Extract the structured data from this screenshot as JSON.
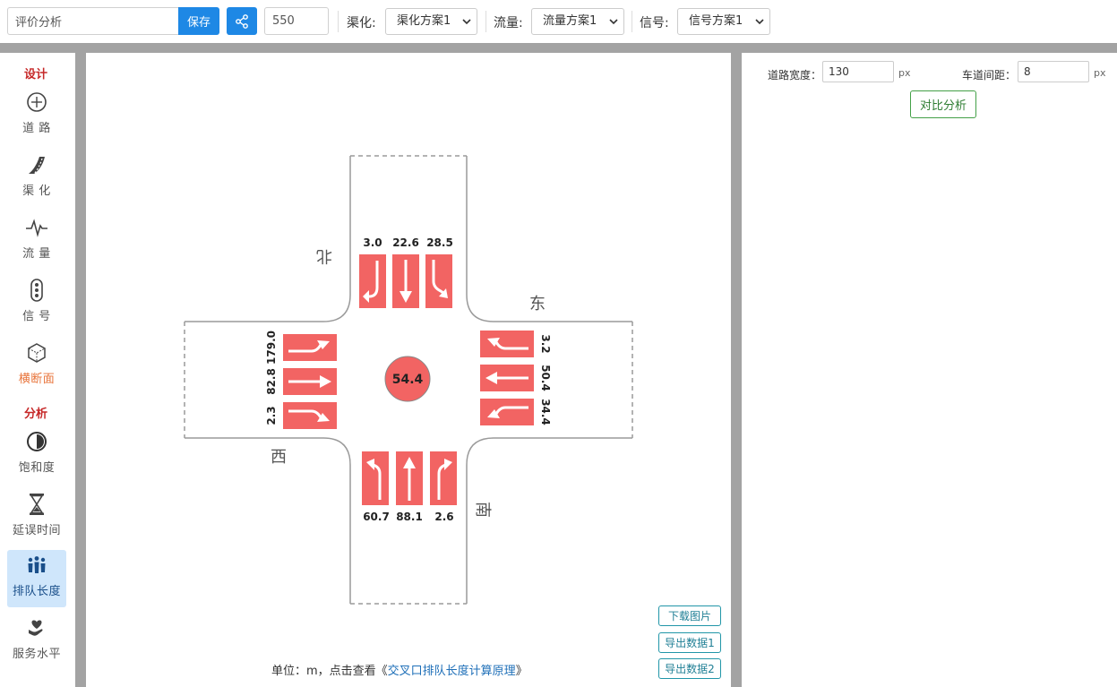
{
  "toolbar": {
    "name_value": "评价分析",
    "save_label": "保存",
    "number_value": "550",
    "channelization_label": "渠化:",
    "channelization_value": "渠化方案1",
    "flow_label": "流量:",
    "flow_value": "流量方案1",
    "signal_label": "信号:",
    "signal_value": "信号方案1"
  },
  "sidebar": {
    "design_section": "设计",
    "analysis_section": "分析",
    "design_items": [
      {
        "label": "道 路",
        "icon": "crosshair-circle-icon"
      },
      {
        "label": "渠 化",
        "icon": "road-curve-icon"
      },
      {
        "label": "流 量",
        "icon": "pulse-icon"
      },
      {
        "label": "信 号",
        "icon": "traffic-light-icon"
      },
      {
        "label": "横断面",
        "icon": "cube-icon"
      }
    ],
    "analysis_items": [
      {
        "label": "饱和度",
        "icon": "half-circle-icon"
      },
      {
        "label": "延误时间",
        "icon": "hourglass-icon"
      },
      {
        "label": "排队长度",
        "icon": "people-queue-icon"
      },
      {
        "label": "服务水平",
        "icon": "heart-hand-icon"
      }
    ],
    "active_item": "排队长度"
  },
  "intersection": {
    "center_value": "54.4",
    "directions": {
      "north": "北",
      "south": "南",
      "east": "东",
      "west": "西"
    },
    "north_values": [
      "3.0",
      "22.6",
      "28.5"
    ],
    "south_values": [
      "60.7",
      "88.1",
      "2.6"
    ],
    "west_values": [
      "179.0",
      "82.8",
      "2.3"
    ],
    "east_values": [
      "3.2",
      "50.4",
      "34.4"
    ],
    "arrow_color": "#f26463",
    "center_color": "#f26463"
  },
  "canvas_buttons": {
    "download_image": "下载图片",
    "export_data1": "导出数据1",
    "export_data2": "导出数据2"
  },
  "footnote": {
    "prefix": "单位：m，点击查看《",
    "link": "交叉口排队长度计算原理",
    "suffix": "》"
  },
  "right_panel": {
    "road_width_label": "道路宽度：",
    "road_width_value": "130",
    "lane_spacing_label": "车道间距：",
    "lane_spacing_value": "8",
    "unit": "px",
    "compare_label": "对比分析"
  },
  "colors": {
    "primary": "#1e88e5",
    "section_red": "#c62828",
    "active_bg": "#cfe6fb",
    "gutter": "#a3a3a3",
    "compare_green": "#43a047"
  }
}
